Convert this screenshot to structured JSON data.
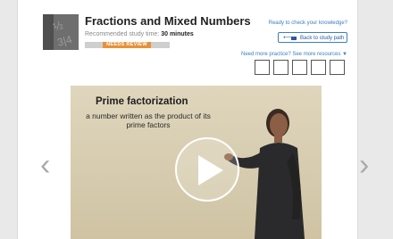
{
  "lesson": {
    "title": "Fractions and Mixed Numbers",
    "recommended_label": "Recommended study time:",
    "recommended_value": "30 minutes",
    "badge": "NEEDS REVIEW",
    "progress_fraction": 0.2
  },
  "links": {
    "ready": "Ready to check your knowledge?",
    "back_button": "Back to study path",
    "more_resources": "Need more practice? See more resources"
  },
  "resources": {
    "box_count": 5
  },
  "video": {
    "slide_title": "Prime factorization",
    "slide_subtitle": "a number written as the product of its prime factors"
  },
  "nav": {
    "prev": "‹",
    "next": "›"
  },
  "colors": {
    "accent": "#3c7ec2",
    "badge": "#e8913a"
  }
}
